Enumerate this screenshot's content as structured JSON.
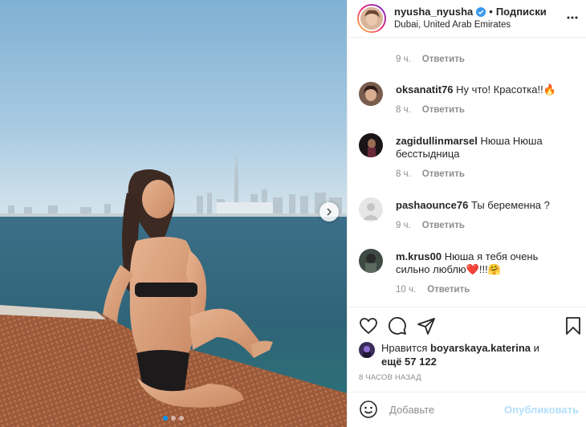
{
  "header": {
    "username": "nyusha_nyusha",
    "separator": "•",
    "follow_label": "Подписки",
    "location": "Dubai, United Arab Emirates"
  },
  "top_time": {
    "time": "9 ч.",
    "reply": "Ответить"
  },
  "comments": [
    {
      "username": "oksanatit76",
      "text": "Ну что! Красотка!!🔥",
      "time": "8 ч.",
      "reply": "Ответить"
    },
    {
      "username": "zagidullinmarsel",
      "text": "Нюша Нюша бесстыдница",
      "time": "8 ч.",
      "reply": "Ответить"
    },
    {
      "username": "pashaounce76",
      "text": "Ты беременна ?",
      "time": "9 ч.",
      "reply": "Ответить"
    },
    {
      "username": "m.krus00",
      "text": "Нюша я тебя очень сильно люблю❤️!!!🤗",
      "time": "10 ч.",
      "reply": "Ответить"
    }
  ],
  "likes": {
    "prefix": "Нравится",
    "user": "boyarskaya.katerina",
    "middle": "и",
    "more": "ещё 57 122"
  },
  "posted_ago": "8 ЧАСОВ НАЗАД",
  "add_comment": {
    "placeholder": "Добавьте",
    "publish": "Опубликовать"
  },
  "carousel": {
    "total": 3,
    "active_index": 0
  },
  "icons": {
    "verified": "verified-badge-icon",
    "more": "more-options-icon",
    "like": "heart-icon",
    "comment": "comment-icon",
    "share": "share-icon",
    "save": "bookmark-icon",
    "emoji": "emoji-icon",
    "next": "chevron-right-icon"
  },
  "colors": {
    "accent": "#0095f6",
    "publish_disabled": "#b2dffc",
    "muted": "#8e8e8e",
    "text": "#262626"
  }
}
